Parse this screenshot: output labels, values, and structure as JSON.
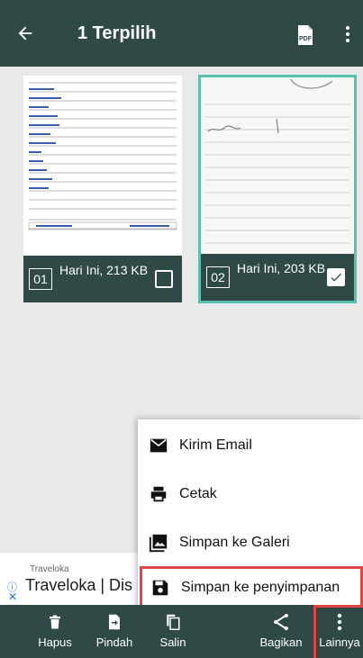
{
  "appbar": {
    "title": "1 Terpilih",
    "back_icon": "arrow-left-icon",
    "pdf_icon": "pdf-icon",
    "pdf_label": "PDF",
    "more_icon": "more-vertical-icon"
  },
  "thumbnails": [
    {
      "number": "01",
      "info": "Hari Ini, 213 KB",
      "checked": false
    },
    {
      "number": "02",
      "info": "Hari Ini, 203 KB",
      "checked": true
    }
  ],
  "ad": {
    "brand_small": "Traveloka",
    "headline": "Traveloka | Dis",
    "info_icon": "info-icon",
    "close_icon": "close-icon"
  },
  "menu": {
    "items": [
      {
        "label": "Kirim Email",
        "icon": "email-icon"
      },
      {
        "label": "Cetak",
        "icon": "print-icon"
      },
      {
        "label": "Simpan ke Galeri",
        "icon": "gallery-icon"
      },
      {
        "label": "Simpan ke penyimpanan",
        "icon": "save-icon",
        "highlighted": true
      }
    ]
  },
  "toolbar": {
    "items": [
      {
        "label": "Hapus",
        "icon": "trash-icon"
      },
      {
        "label": "Pindah",
        "icon": "move-icon"
      },
      {
        "label": "Salin",
        "icon": "copy-icon"
      },
      {
        "label": "Bagikan",
        "icon": "share-icon"
      },
      {
        "label": "Lainnya",
        "icon": "more-vertical-icon",
        "highlighted": true
      }
    ]
  },
  "colors": {
    "bar": "#2f4a46",
    "selected_border": "#58bfb1",
    "highlight": "#e04545"
  }
}
